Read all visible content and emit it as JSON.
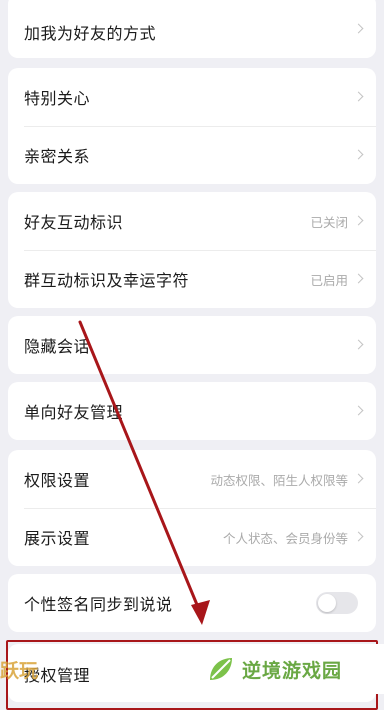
{
  "settings": {
    "add_friend_method": "加我为好友的方式",
    "special_care": "特别关心",
    "intimate_relation": "亲密关系",
    "friend_interaction_mark": {
      "label": "好友互动标识",
      "value": "已关闭"
    },
    "group_interaction_mark": {
      "label": "群互动标识及幸运字符",
      "value": "已启用"
    },
    "hidden_chats": "隐藏会话",
    "one_way_friends": "单向好友管理",
    "permission_settings": {
      "label": "权限设置",
      "value": "动态权限、陌生人权限等"
    },
    "display_settings": {
      "label": "展示设置",
      "value": "个人状态、会员身份等"
    },
    "signature_sync": {
      "label": "个性签名同步到说说",
      "enabled": false
    },
    "authorization_management": "授权管理"
  },
  "annotation": {
    "color": "#a8161a"
  },
  "watermark": {
    "brand_text": "逆境游戏园",
    "logo": "leaf-logo-icon",
    "left_text": "跃玩"
  }
}
